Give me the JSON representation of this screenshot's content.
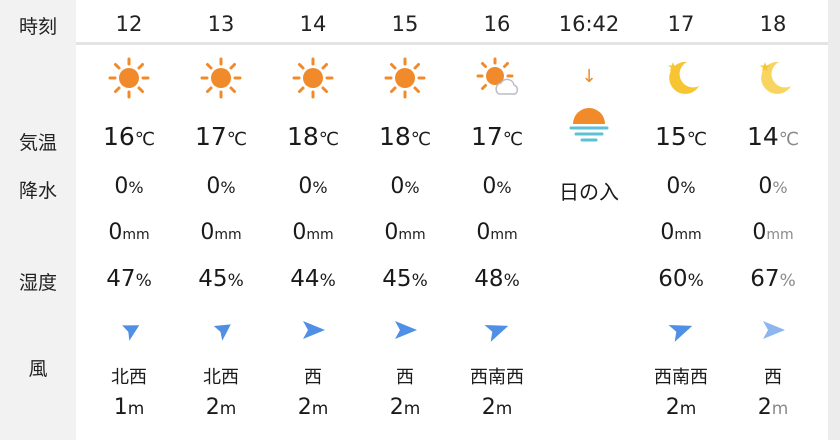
{
  "labels": {
    "time": "時刻",
    "temperature": "気温",
    "precipitation": "降水",
    "humidity": "湿度",
    "wind": "風"
  },
  "columns": [
    {
      "hour": "12",
      "icon": "sun-icon",
      "temp": "16",
      "temp_unit": "℃",
      "rain": "0",
      "rain_unit": "%",
      "mm": "0",
      "mm_unit": "mm",
      "humidity": "47",
      "humidity_unit": "%",
      "wind_dir": "北西",
      "wind_speed": "1",
      "wind_unit": "m"
    },
    {
      "hour": "13",
      "icon": "sun-icon",
      "temp": "17",
      "temp_unit": "℃",
      "rain": "0",
      "rain_unit": "%",
      "mm": "0",
      "mm_unit": "mm",
      "humidity": "45",
      "humidity_unit": "%",
      "wind_dir": "北西",
      "wind_speed": "2",
      "wind_unit": "m"
    },
    {
      "hour": "14",
      "icon": "sun-icon",
      "temp": "18",
      "temp_unit": "℃",
      "rain": "0",
      "rain_unit": "%",
      "mm": "0",
      "mm_unit": "mm",
      "humidity": "44",
      "humidity_unit": "%",
      "wind_dir": "西",
      "wind_speed": "2",
      "wind_unit": "m"
    },
    {
      "hour": "15",
      "icon": "sun-icon",
      "temp": "18",
      "temp_unit": "℃",
      "rain": "0",
      "rain_unit": "%",
      "mm": "0",
      "mm_unit": "mm",
      "humidity": "45",
      "humidity_unit": "%",
      "wind_dir": "西",
      "wind_speed": "2",
      "wind_unit": "m"
    },
    {
      "hour": "16",
      "icon": "sun-cloud-icon",
      "temp": "17",
      "temp_unit": "℃",
      "rain": "0",
      "rain_unit": "%",
      "mm": "0",
      "mm_unit": "mm",
      "humidity": "48",
      "humidity_unit": "%",
      "wind_dir": "西南西",
      "wind_speed": "2",
      "wind_unit": "m"
    },
    {
      "hour": "16:42",
      "icon": "sunset-icon",
      "sunset_label": "日の入",
      "arrow": "↓"
    },
    {
      "hour": "17",
      "icon": "moon-icon",
      "temp": "15",
      "temp_unit": "℃",
      "rain": "0",
      "rain_unit": "%",
      "mm": "0",
      "mm_unit": "mm",
      "humidity": "60",
      "humidity_unit": "%",
      "wind_dir": "西南西",
      "wind_speed": "2",
      "wind_unit": "m"
    },
    {
      "hour": "18",
      "icon": "moon-icon",
      "temp": "14",
      "temp_unit": "℃",
      "rain": "0",
      "rain_unit": "%",
      "mm": "0",
      "mm_unit": "mm",
      "humidity": "67",
      "humidity_unit": "%",
      "wind_dir": "西",
      "wind_speed": "2",
      "wind_unit": "m"
    }
  ],
  "colors": {
    "sun": "#f08a2a",
    "moon": "#f6c531",
    "wind_arrow": "#4f8fe6",
    "faded_text": "#8a8a8a"
  }
}
